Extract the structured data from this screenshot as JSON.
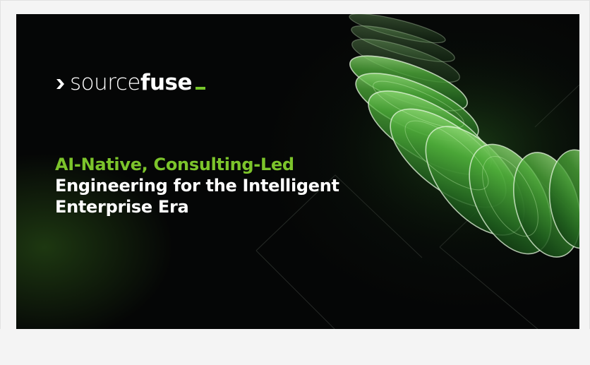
{
  "slide": {
    "logo": {
      "text_light": "source",
      "text_bold": "fuse",
      "chevron_icon": "chevron-right-icon",
      "accent_color": "#76c52a"
    },
    "headline": {
      "line1": "AI-Native, Consulting-Led",
      "line2": "Engineering for the Intelligent",
      "line3": "Enterprise Era"
    },
    "colors": {
      "background": "#050606",
      "accent": "#7cc42b",
      "text": "#ffffff",
      "page": "#f4f4f4"
    }
  }
}
